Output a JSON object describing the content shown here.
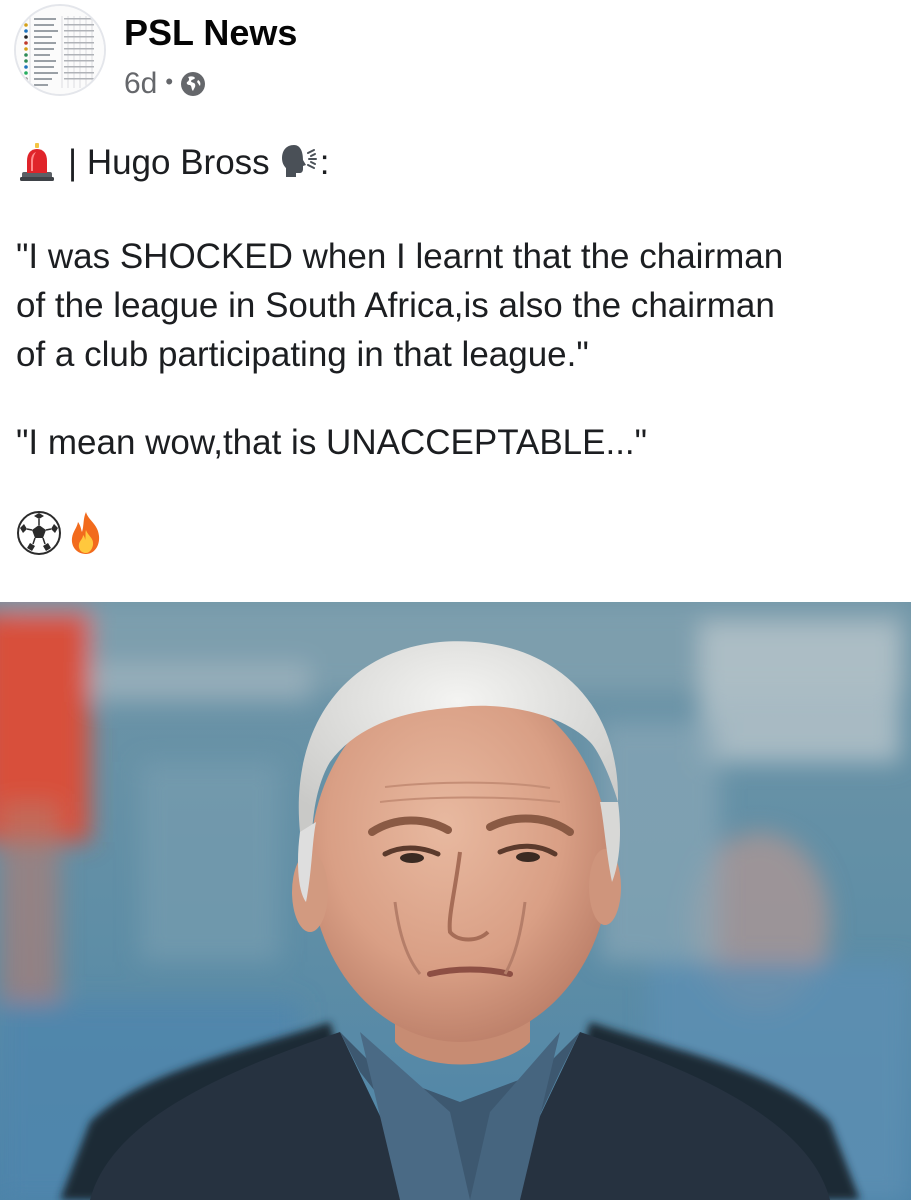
{
  "post": {
    "page_name": "PSL News",
    "time_ago": "6d",
    "separator": "•",
    "privacy_icon": "globe-icon",
    "avatar_icon": "league-table-thumbnail",
    "text": {
      "headline_prefix": "| Hugo Bross",
      "headline_suffix": ":",
      "quote_line1": "\"I was SHOCKED when I learnt that the chairman",
      "quote_line2": "of the league in South Africa,is also the chairman",
      "quote_line3": "of a club participating in that league.\"",
      "quote2": "\"I mean wow,that is UNACCEPTABLE...\""
    },
    "emojis": {
      "siren": "rotating-light-emoji",
      "speaking": "speaking-head-emoji",
      "ball": "soccer-ball-emoji",
      "fire": "fire-emoji"
    },
    "photo": {
      "subject": "portrait-photo"
    },
    "colors": {
      "name": "#050505",
      "meta": "#65676b",
      "text": "#1c1e21"
    }
  }
}
